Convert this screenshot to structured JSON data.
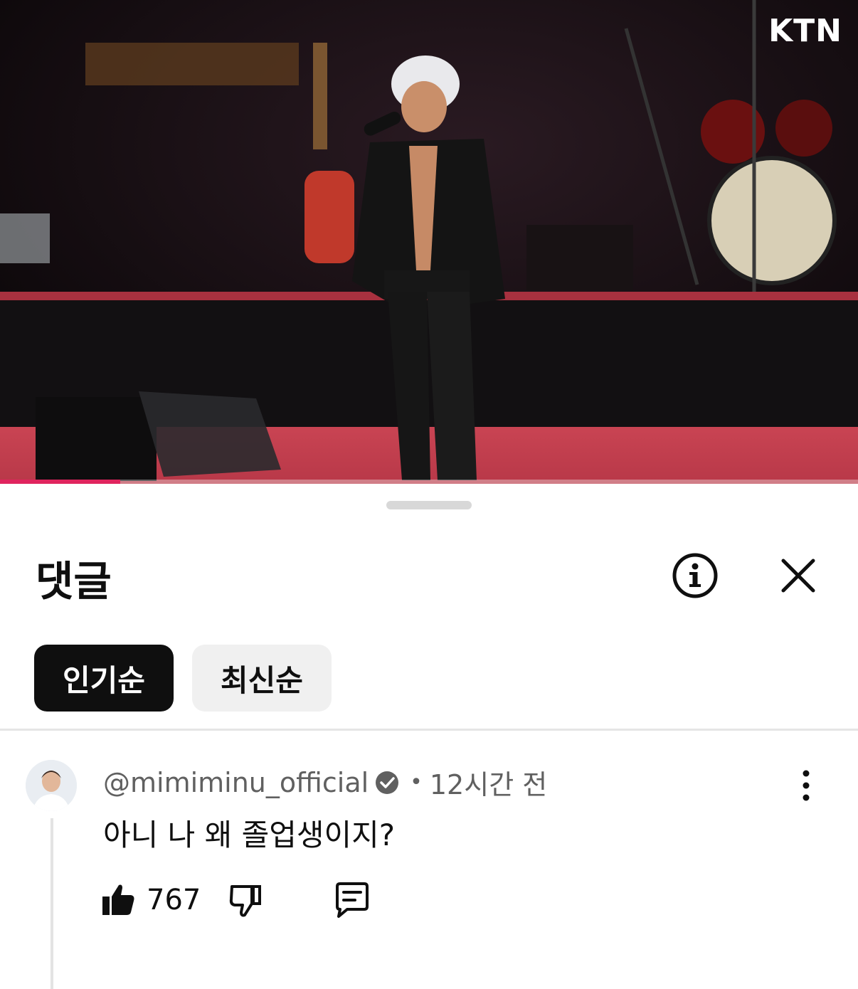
{
  "video": {
    "watermark": "KTN",
    "progress_fraction": 0.14
  },
  "comments_panel": {
    "title": "댓글",
    "icons": {
      "info": "info-icon",
      "close": "close-icon"
    },
    "sort_chips": [
      {
        "label": "인기순",
        "selected": true
      },
      {
        "label": "최신순",
        "selected": false
      }
    ]
  },
  "comment": {
    "author": "@mimiminu_official",
    "verified": true,
    "separator": "•",
    "time": "12시간 전",
    "text": "아니 나 왜 졸업생이지?",
    "likes": "767"
  },
  "colors": {
    "primary_text": "#0f0f0f",
    "secondary_text": "#606060",
    "chip_active_bg": "#0f0f0f",
    "chip_inactive_bg": "#f0f0f0",
    "progress": "#e0245e"
  }
}
